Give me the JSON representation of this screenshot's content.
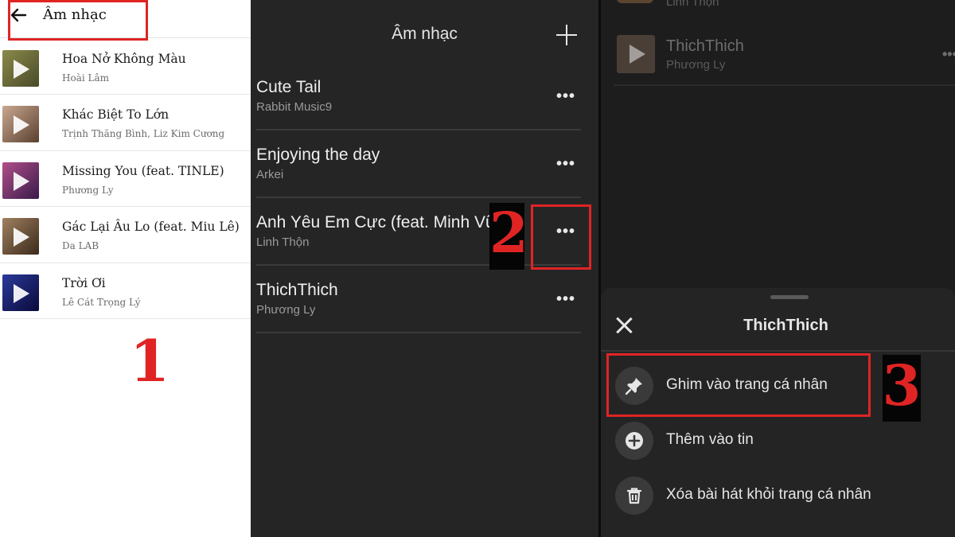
{
  "panel1": {
    "title": "Âm nhạc",
    "step": "1",
    "songs": [
      {
        "name": "Hoa Nở Không Màu",
        "artist": "Hoài Lâm",
        "thumb_color": "#6b6a3a"
      },
      {
        "name": "Khác Biệt To Lớn",
        "artist": "Trịnh Thăng Bình, Liz Kim Cương",
        "thumb_color": "#8a6a5a"
      },
      {
        "name": "Missing You (feat. TINLE)",
        "artist": "Phương Ly",
        "thumb_color": "#7a3a6a"
      },
      {
        "name": "Gác Lại Âu Lo (feat. Miu Lê)",
        "artist": "Da LAB",
        "thumb_color": "#5a4a3a"
      },
      {
        "name": "Trời Ơi",
        "artist": "Lê Cát Trọng Lý",
        "thumb_color": "#1e2a6a"
      }
    ]
  },
  "panel2": {
    "title": "Âm nhạc",
    "step": "2",
    "more_label": "•••",
    "songs": [
      {
        "name": "Cute Tail",
        "artist": "Rabbit Music9"
      },
      {
        "name": "Enjoying the day",
        "artist": "Arkei"
      },
      {
        "name": "Anh Yêu Em Cực (feat. Minh Vũ)",
        "artist": "Linh Thộn"
      },
      {
        "name": "ThichThich",
        "artist": "Phương Ly"
      }
    ]
  },
  "panel3": {
    "top_artist": "Linh Thộn",
    "song": {
      "name": "ThichThich",
      "artist": "Phương Ly"
    },
    "more_label": "•••",
    "sheet": {
      "title": "ThichThich",
      "options": [
        {
          "label": "Ghim vào trang cá nhân",
          "icon": "pin-icon"
        },
        {
          "label": "Thêm vào tin",
          "icon": "add-circle-icon"
        },
        {
          "label": "Xóa bài hát khỏi trang cá nhân",
          "icon": "trash-icon"
        }
      ]
    },
    "step": "3"
  },
  "colors": {
    "highlight": "#e02424",
    "dark_bg": "#252526",
    "light_bg": "#ffffff"
  }
}
